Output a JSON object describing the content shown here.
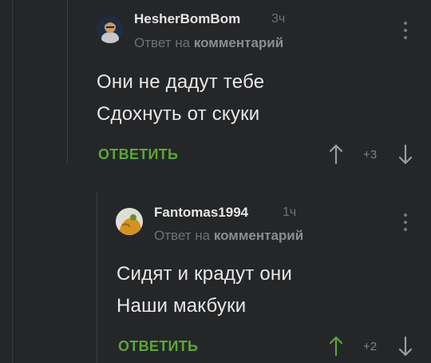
{
  "comments": [
    {
      "author": "HesherBomBom",
      "time": "3ч",
      "reply_prefix": "Ответ на",
      "reply_link": "комментарий",
      "lines": [
        "Они не дадут тебе",
        "Сдохнуть от скуки"
      ],
      "reply_label": "ОТВЕТИТЬ",
      "rating": "+3",
      "upvote_color": "#9a9c9f",
      "downvote_color": "#9a9c9f"
    },
    {
      "author": "Fantomas1994",
      "time": "1ч",
      "reply_prefix": "Ответ на",
      "reply_link": "комментарий",
      "lines": [
        "Сидят и крадут они",
        "Наши макбуки"
      ],
      "reply_label": "ОТВЕТИТЬ",
      "rating": "+2",
      "upvote_color": "#5da43a",
      "downvote_color": "#9a9c9f"
    }
  ],
  "colors": {
    "background": "#252628",
    "accent_green": "#5da43a",
    "thread_line": "#3b3c3f",
    "muted_text": "#6e7075"
  }
}
